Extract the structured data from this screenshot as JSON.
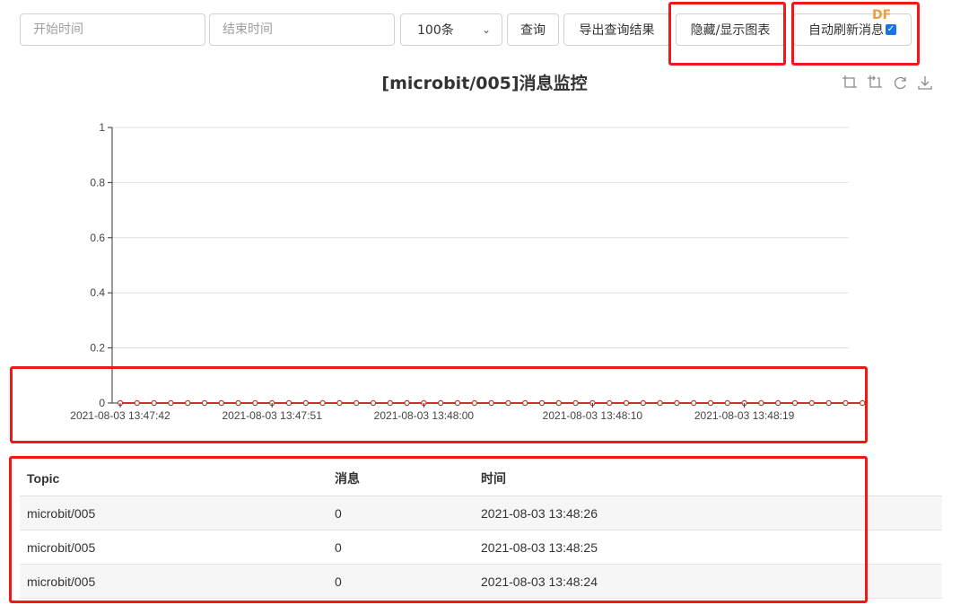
{
  "toolbar": {
    "start_placeholder": "开始时间",
    "end_placeholder": "结束时间",
    "limit_value": "100条",
    "query_label": "查询",
    "export_label": "导出查询结果",
    "toggle_chart_label": "隐藏/显示图表",
    "auto_refresh_label": "自动刷新消息",
    "auto_refresh_checked": true
  },
  "watermark": "DF",
  "chart": {
    "title": "[microbit/005]消息监控",
    "toolbox_icons": [
      "zoom-icon",
      "zoom-reset-icon",
      "restore-icon",
      "download-icon"
    ]
  },
  "chart_data": {
    "type": "line",
    "title": "[microbit/005]消息监控",
    "xlabel": "",
    "ylabel": "",
    "ylim": [
      0,
      1
    ],
    "yticks": [
      "0",
      "0.2",
      "0.4",
      "0.6",
      "0.8",
      "1"
    ],
    "xtick_labels": [
      "2021-08-03 13:47:42",
      "2021-08-03 13:47:51",
      "2021-08-03 13:48:00",
      "2021-08-03 13:48:10",
      "2021-08-03 13:48:19"
    ],
    "grid": true,
    "series": [
      {
        "color": "#c23531",
        "x": [
          "2021-08-03 13:47:42",
          "2021-08-03 13:47:43",
          "2021-08-03 13:47:44",
          "2021-08-03 13:47:45",
          "2021-08-03 13:47:46",
          "2021-08-03 13:47:47",
          "2021-08-03 13:47:48",
          "2021-08-03 13:47:49",
          "2021-08-03 13:47:50",
          "2021-08-03 13:47:51",
          "2021-08-03 13:47:52",
          "2021-08-03 13:47:53",
          "2021-08-03 13:47:54",
          "2021-08-03 13:47:55",
          "2021-08-03 13:47:56",
          "2021-08-03 13:47:57",
          "2021-08-03 13:47:58",
          "2021-08-03 13:47:59",
          "2021-08-03 13:48:00",
          "2021-08-03 13:48:01",
          "2021-08-03 13:48:02",
          "2021-08-03 13:48:03",
          "2021-08-03 13:48:04",
          "2021-08-03 13:48:05",
          "2021-08-03 13:48:06",
          "2021-08-03 13:48:07",
          "2021-08-03 13:48:08",
          "2021-08-03 13:48:09",
          "2021-08-03 13:48:10",
          "2021-08-03 13:48:11",
          "2021-08-03 13:48:12",
          "2021-08-03 13:48:13",
          "2021-08-03 13:48:14",
          "2021-08-03 13:48:15",
          "2021-08-03 13:48:16",
          "2021-08-03 13:48:17",
          "2021-08-03 13:48:18",
          "2021-08-03 13:48:19",
          "2021-08-03 13:48:20",
          "2021-08-03 13:48:21",
          "2021-08-03 13:48:22",
          "2021-08-03 13:48:23",
          "2021-08-03 13:48:24",
          "2021-08-03 13:48:25",
          "2021-08-03 13:48:26"
        ],
        "values": [
          0,
          0,
          0,
          0,
          0,
          0,
          0,
          0,
          0,
          0,
          0,
          0,
          0,
          0,
          0,
          0,
          0,
          0,
          0,
          0,
          0,
          0,
          0,
          0,
          0,
          0,
          0,
          0,
          0,
          0,
          0,
          0,
          0,
          0,
          0,
          0,
          0,
          0,
          0,
          0,
          0,
          0,
          0,
          0,
          0
        ]
      }
    ]
  },
  "table": {
    "headers": [
      "Topic",
      "消息",
      "时间"
    ],
    "rows": [
      [
        "microbit/005",
        "0",
        "2021-08-03 13:48:26"
      ],
      [
        "microbit/005",
        "0",
        "2021-08-03 13:48:25"
      ],
      [
        "microbit/005",
        "0",
        "2021-08-03 13:48:24"
      ]
    ]
  },
  "colors": {
    "highlight": "#f01818",
    "series": "#c23531",
    "checkbox": "#1a73e8"
  }
}
